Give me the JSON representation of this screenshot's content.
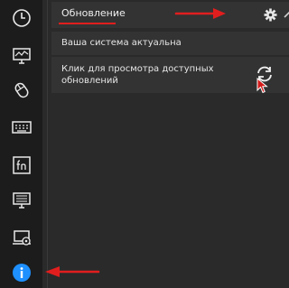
{
  "sidebar": {
    "items": [
      {
        "icon": "clock-icon"
      },
      {
        "icon": "monitor-graph-icon"
      },
      {
        "icon": "mouse-icon"
      },
      {
        "icon": "keyboard-icon"
      },
      {
        "icon": "fn-key-icon"
      },
      {
        "icon": "display-list-icon"
      },
      {
        "icon": "laptop-settings-icon"
      },
      {
        "icon": "info-icon",
        "active": true
      }
    ]
  },
  "panel": {
    "title": "Обновление",
    "status": "Ваша система актуальна",
    "check_line1": "Клик для просмотра доступных",
    "check_line2": "обновлений"
  },
  "colors": {
    "accent": "#1e90ff",
    "annotation": "#e11e1e"
  }
}
